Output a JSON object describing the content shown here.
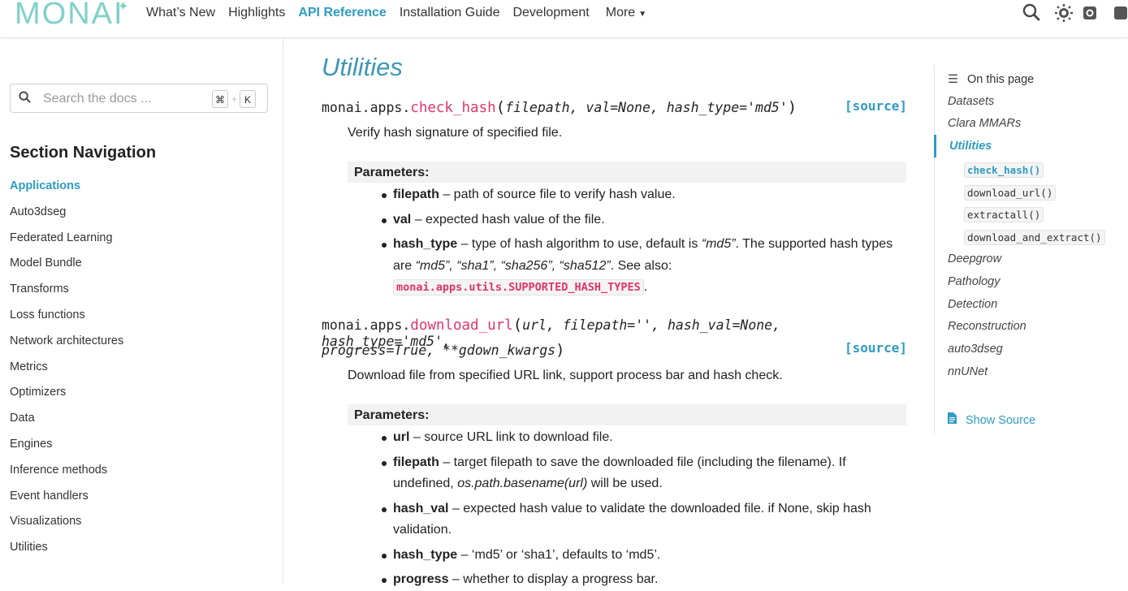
{
  "logo": "MONAI",
  "nav": {
    "items": [
      "What’s New",
      "Highlights",
      "API Reference",
      "Installation Guide",
      "Development"
    ],
    "more": "More"
  },
  "icons": {
    "search": "search-icon",
    "theme": "theme-toggle-icon",
    "github": "github-icon",
    "expand": "expand-icon"
  },
  "search": {
    "placeholder": "Search the docs ...",
    "key1": "⌘",
    "key2": "K"
  },
  "sidebar": {
    "title": "Section Navigation",
    "items": [
      "Applications",
      "Auto3dseg",
      "Federated Learning",
      "Model Bundle",
      "Transforms",
      "Loss functions",
      "Network architectures",
      "Metrics",
      "Optimizers",
      "Data",
      "Engines",
      "Inference methods",
      "Event handlers",
      "Visualizations",
      "Utilities"
    ]
  },
  "content": {
    "title": "Utilities",
    "check_hash": {
      "module": "monai.apps.",
      "name": "check_hash",
      "args": "filepath, val=None, hash_type='md5'",
      "source": "[source]",
      "desc": "Verify hash signature of specified file.",
      "params_label": "Parameters:",
      "p1_name": "filepath",
      "p1_desc": " – path of source file to verify hash value.",
      "p2_name": "val",
      "p2_desc": " – expected hash value of the file.",
      "p3_name": "hash_type",
      "p3_desc1": " – type of hash algorithm to use, default is ",
      "p3_default": "“md5”",
      "p3_desc2": ". The supported hash types are ",
      "p3_types": "“md5”, “sha1”, “sha256”, “sha512”",
      "p3_desc3": ". See also: ",
      "p3_code": "monai.apps.utils.SUPPORTED_HASH_TYPES",
      "p3_end": "."
    },
    "download_url": {
      "module": "monai.apps.",
      "name": "download_url",
      "args1": "url, filepath='', hash_val=None, hash_type='md5',",
      "args2": "progress=True, **gdown_kwargs",
      "source": "[source]",
      "desc": "Download file from specified URL link, support process bar and hash check.",
      "params_label": "Parameters:",
      "p1_name": "url",
      "p1_desc": " – source URL link to download file.",
      "p2_name": "filepath",
      "p2_desc1": " – target filepath to save the downloaded file (including the filename). If undefined, ",
      "p2_code": "os.path.basename(url)",
      "p2_desc2": " will be used.",
      "p3_name": "hash_val",
      "p3_desc": " – expected hash value to validate the downloaded file. if None, skip hash validation.",
      "p4_name": "hash_type",
      "p4_desc": " – ‘md5’ or ‘sha1’, defaults to ‘md5’.",
      "p5_name": "progress",
      "p5_desc": " – whether to display a progress bar."
    }
  },
  "toc": {
    "header": "On this page",
    "items": [
      "Datasets",
      "Clara MMARs",
      "Utilities",
      "Deepgrow",
      "Pathology",
      "Detection",
      "Reconstruction",
      "auto3dseg",
      "nnUNet"
    ],
    "subitems": [
      "check_hash()",
      "download_url()",
      "extractall()",
      "download_and_extract()"
    ],
    "show_source": "Show Source"
  },
  "colors": {
    "accent": "#2e9bc4",
    "code": "#e0356b",
    "logo": "#7fd1c8"
  }
}
